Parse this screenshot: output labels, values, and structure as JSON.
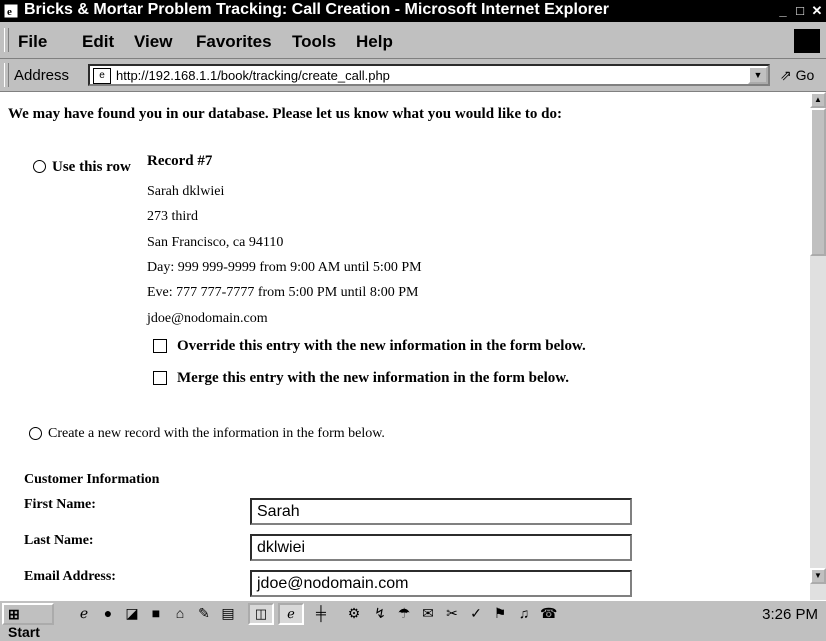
{
  "window": {
    "title": "Bricks & Mortar Problem Tracking: Call Creation - Microsoft Internet Explorer",
    "min_label": "_",
    "max_label": "□",
    "close_label": "✕"
  },
  "menu": {
    "items": [
      {
        "label": "File",
        "key": "F"
      },
      {
        "label": "Edit",
        "key": "E"
      },
      {
        "label": "View",
        "key": "V"
      },
      {
        "label": "Favorites",
        "key": "a"
      },
      {
        "label": "Tools",
        "key": "T"
      },
      {
        "label": "Help",
        "key": "H"
      }
    ]
  },
  "address": {
    "label": "Address",
    "url": "http://192.168.1.1/book/tracking/create_call.php",
    "go_label": "Go"
  },
  "page": {
    "intro": "We may have found you in our database. Please let us know what you would like to do:",
    "use_row_label": "Use this row",
    "record_title": "Record #7",
    "record_lines": [
      "Sarah dklwiei",
      "273 third",
      "San Francisco, ca 94110",
      "Day: 999 999-9999 from 9:00 AM until 5:00 PM",
      "Eve: 777 777-7777 from 5:00 PM until 8:00 PM",
      "jdoe@nodomain.com"
    ],
    "override_label": "Override this entry with the new information in the form below.",
    "merge_label": "Merge this entry with the new information in the form below.",
    "create_label": "Create a new record with the information in the form below.",
    "customer_section": "Customer Information",
    "fields": [
      {
        "label": "First Name:",
        "value": "Sarah"
      },
      {
        "label": "Last Name:",
        "value": "dklwiei"
      },
      {
        "label": "Email Address:",
        "value": "jdoe@nodomain.com"
      }
    ]
  },
  "taskbar": {
    "start_label": "Start",
    "clock": "3:26 PM"
  }
}
